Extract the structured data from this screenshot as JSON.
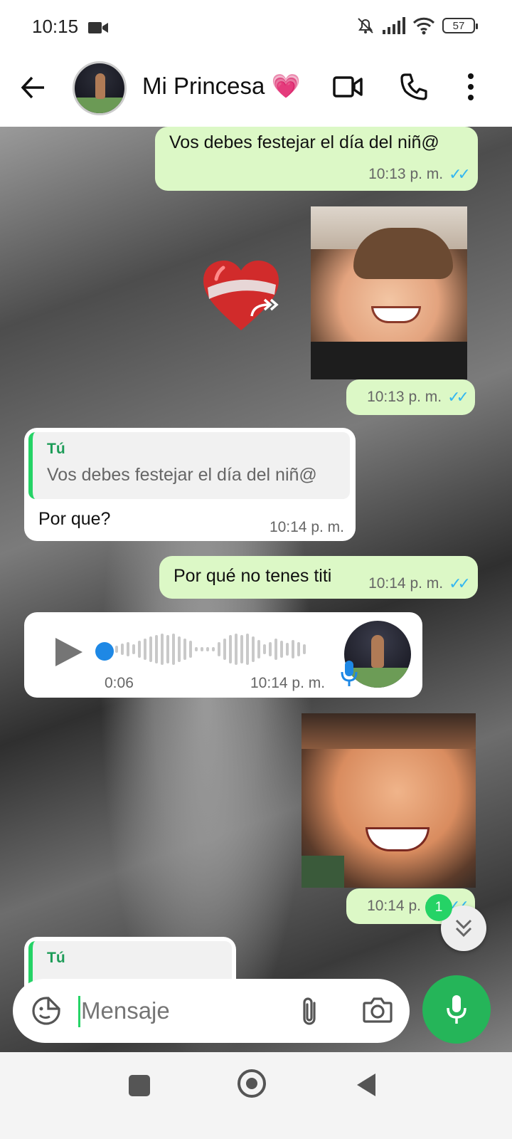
{
  "status_bar": {
    "time": "10:15",
    "battery": "57"
  },
  "header": {
    "contact_name": "Mi Princesa 💗"
  },
  "messages": {
    "m1": {
      "text": "Vos debes festejar el día del niñ@",
      "time": "10:13 p. m."
    },
    "m2": {
      "time": "10:13 p. m."
    },
    "m3": {
      "reply_author": "Tú",
      "reply_text": "Vos debes festejar el día del niñ@",
      "text": "Por que?",
      "time": "10:14 p. m."
    },
    "m4": {
      "text": "Por qué no tenes titi",
      "time": "10:14 p. m."
    },
    "m5": {
      "duration": "0:06",
      "time": "10:14 p. m."
    },
    "m6": {
      "time": "10:14 p. m."
    },
    "m7": {
      "reply_author": "Tú"
    }
  },
  "unread_badge": "1",
  "input": {
    "placeholder": "Mensaje"
  },
  "icons": {
    "sticker": "heart-sticker",
    "forward": "forward-icon",
    "read": "double-check-icon"
  },
  "colors": {
    "outgoing_bubble": "#dcf8c6",
    "incoming_bubble": "#ffffff",
    "accent": "#25d366",
    "read_ticks": "#34b7f1"
  }
}
